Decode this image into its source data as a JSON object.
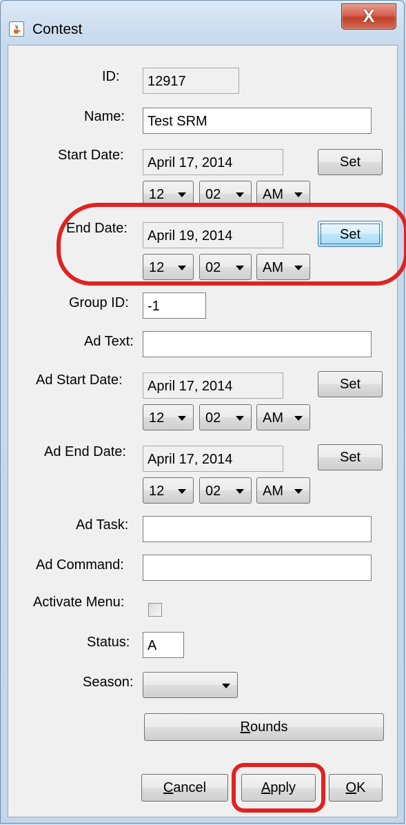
{
  "window": {
    "title": "Contest",
    "close_glyph": "X",
    "icon": "java-cup-icon"
  },
  "form": {
    "id": {
      "label": "ID:",
      "value": "12917"
    },
    "name": {
      "label": "Name:",
      "value": "Test SRM"
    },
    "start_date": {
      "label": "Start Date:",
      "value": "April 17, 2014",
      "set": "Set",
      "hour": "12",
      "minute": "02",
      "ampm": "AM"
    },
    "end_date": {
      "label": "End Date:",
      "value": "April 19, 2014",
      "set": "Set",
      "hour": "12",
      "minute": "02",
      "ampm": "AM"
    },
    "group_id": {
      "label": "Group ID:",
      "value": "-1"
    },
    "ad_text": {
      "label": "Ad Text:",
      "value": ""
    },
    "ad_start_date": {
      "label": "Ad Start Date:",
      "value": "April 17, 2014",
      "set": "Set",
      "hour": "12",
      "minute": "02",
      "ampm": "AM"
    },
    "ad_end_date": {
      "label": "Ad End Date:",
      "value": "April 17, 2014",
      "set": "Set",
      "hour": "12",
      "minute": "02",
      "ampm": "AM"
    },
    "ad_task": {
      "label": "Ad Task:",
      "value": ""
    },
    "ad_command": {
      "label": "Ad Command:",
      "value": ""
    },
    "activate_menu": {
      "label": "Activate Menu:",
      "checked": false
    },
    "status": {
      "label": "Status:",
      "value": "A"
    },
    "season": {
      "label": "Season:",
      "value": ""
    }
  },
  "buttons": {
    "rounds": {
      "mnemonic": "R",
      "rest": "ounds"
    },
    "cancel": {
      "mnemonic": "C",
      "rest": "ancel"
    },
    "apply": {
      "mnemonic": "A",
      "rest": "pply"
    },
    "ok": {
      "mnemonic": "O",
      "rest": "K"
    }
  },
  "colors": {
    "highlight_ring": "#e02222",
    "focus_button": "#bee6fd"
  }
}
